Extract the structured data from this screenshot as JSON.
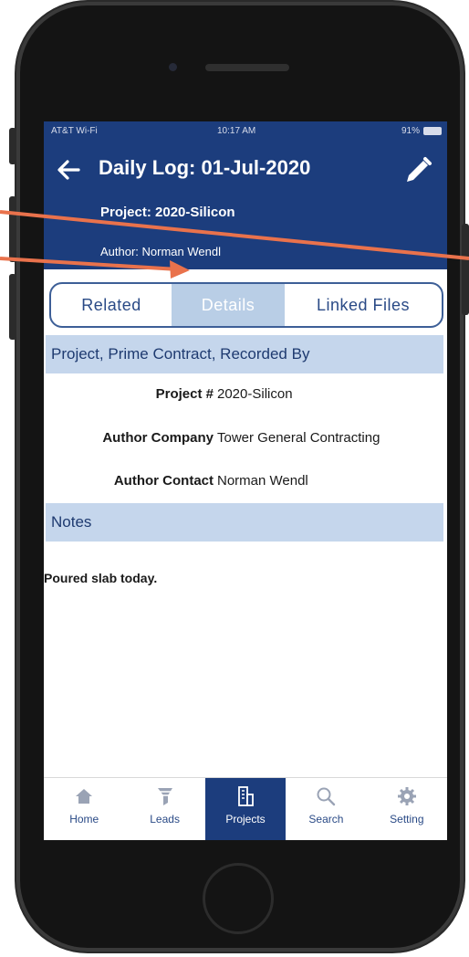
{
  "status": {
    "carrier": "AT&T Wi-Fi",
    "time": "10:17 AM",
    "battery": "91%"
  },
  "header": {
    "title": "Daily Log: 01-Jul-2020",
    "project": "Project: 2020-Silicon",
    "author": "Author: Norman Wendl"
  },
  "tabs": [
    {
      "label": "Related"
    },
    {
      "label": "Details"
    },
    {
      "label": "Linked Files"
    }
  ],
  "sections": {
    "project": "Project, Prime Contract, Recorded By",
    "notes": "Notes"
  },
  "fields": [
    {
      "label": "Project #",
      "value": "2020-Silicon"
    },
    {
      "label": "Author Company",
      "value": "Tower General Contracting"
    },
    {
      "label": "Author Contact",
      "value": "Norman Wendl"
    }
  ],
  "notes_text": "Poured slab today.",
  "tabbar": [
    {
      "label": "Home",
      "icon": "home-icon"
    },
    {
      "label": "Leads",
      "icon": "funnel-icon"
    },
    {
      "label": "Projects",
      "icon": "building-icon"
    },
    {
      "label": "Search",
      "icon": "search-icon"
    },
    {
      "label": "Setting",
      "icon": "gear-icon"
    }
  ],
  "colors": {
    "brand": "#1c3d7d",
    "section_bg": "#c5d6ec",
    "active_tab": "#b9cee6",
    "annotation": "#e9724c"
  }
}
